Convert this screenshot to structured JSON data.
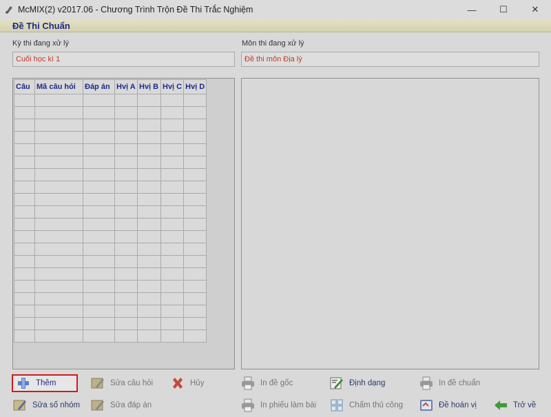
{
  "window": {
    "title": "McMIX(2) v2017.06 - Chương Trình Trộn Đề Thi Trắc Nghiệm",
    "controls": {
      "minimize": "—",
      "maximize": "☐",
      "close": "✕"
    }
  },
  "header": {
    "title": "Đề Thi Chuẩn"
  },
  "fields": {
    "ky_thi": {
      "label": "Kỳ thi đang xử lý",
      "value": "Cuối học kì 1"
    },
    "mon_thi": {
      "label": "Môn thi đang xử lý",
      "value": "Đề thi môn Địa lý"
    }
  },
  "grid": {
    "columns": [
      "Câu",
      "Mã câu hỏi",
      "Đáp án",
      "Hvị A",
      "Hvị B",
      "Hvị C",
      "Hvị D"
    ],
    "rows": 20
  },
  "buttons": {
    "them": "Thêm",
    "sua_cau_hoi": "Sửa câu hỏi",
    "huy": "Hủy",
    "in_de_goc": "In đề gốc",
    "dinh_dang": "Định dạng",
    "in_de_chuan": "In đề chuẩn",
    "sua_so_nhom": "Sửa số nhóm",
    "sua_dap_an": "Sửa đáp án",
    "in_phieu_lam_bai": "In phiếu làm bài",
    "cham_thu_cong": "Chấm thủ công",
    "de_hoan_vi": "Đề hoán vị",
    "tro_ve": "Trở về"
  },
  "colors": {
    "header_text": "#1c2a8a",
    "field_value": "#c0392b",
    "highlight_border": "#d11a1a"
  }
}
